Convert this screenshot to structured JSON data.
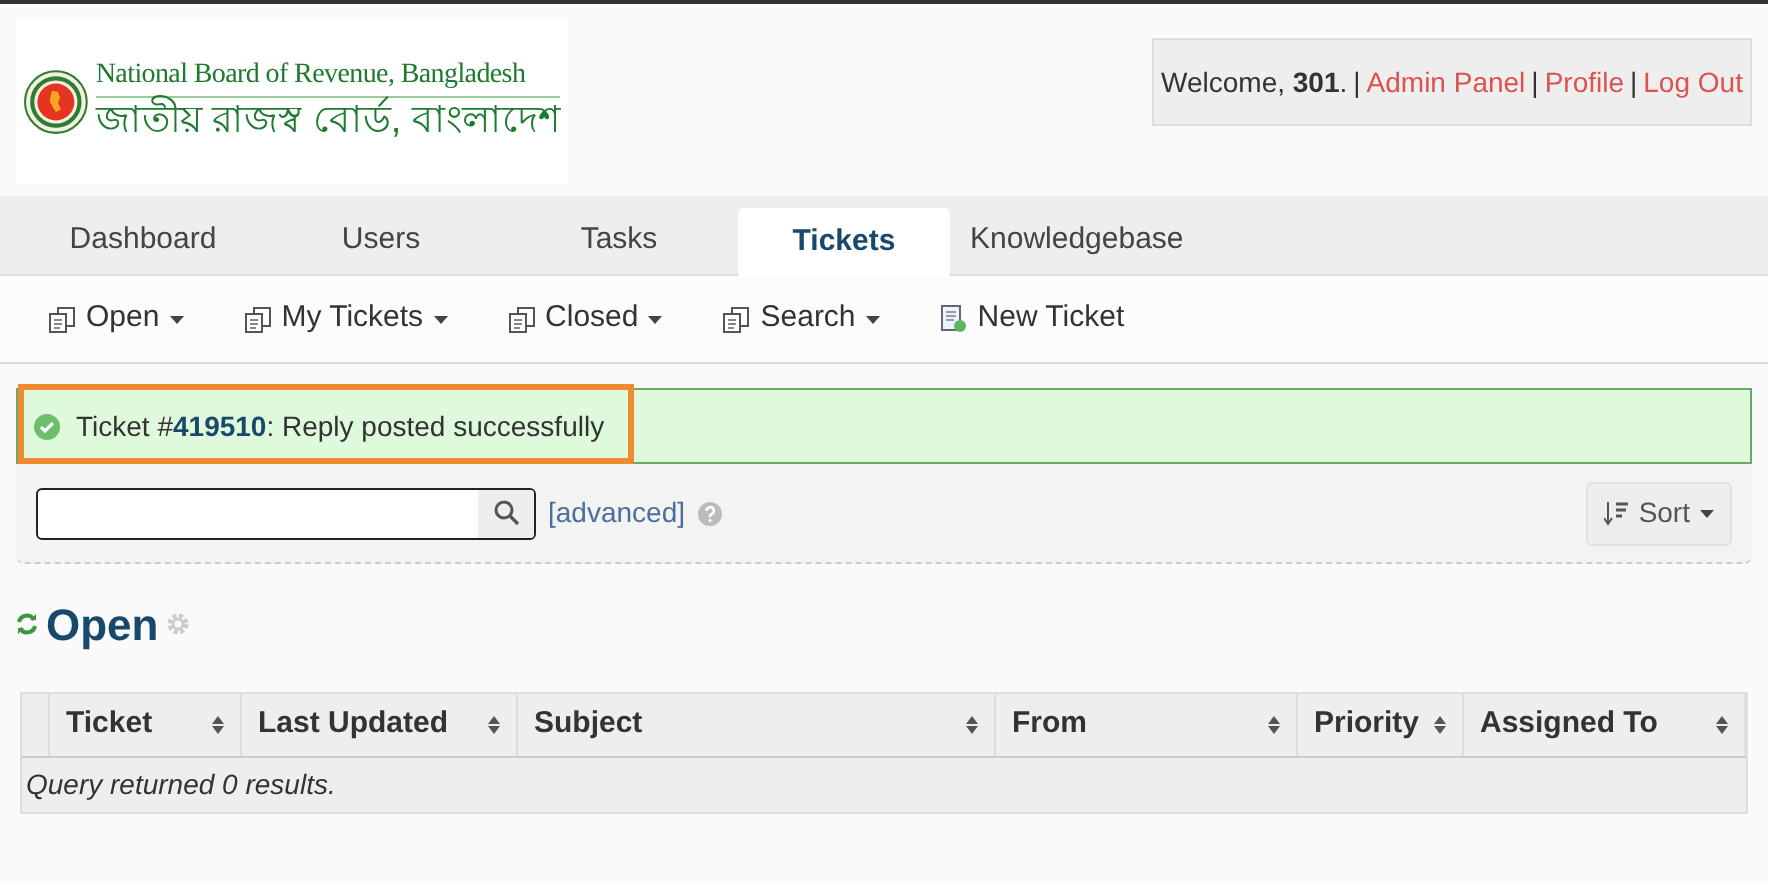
{
  "logo": {
    "english": "National Board of Revenue, Bangladesh",
    "bengali": "জাতীয় রাজস্ব বোর্ড, বাংলাদেশ"
  },
  "user_box": {
    "greeting": "Welcome, ",
    "user": "301",
    "period": ".",
    "separator": "|",
    "links": [
      "Admin Panel",
      "Profile",
      "Log Out"
    ]
  },
  "tabs": [
    {
      "label": "Dashboard",
      "selected": false
    },
    {
      "label": "Users",
      "selected": false
    },
    {
      "label": "Tasks",
      "selected": false
    },
    {
      "label": "Tickets",
      "selected": true
    },
    {
      "label": "Knowledgebase",
      "selected": false
    }
  ],
  "subnav": [
    {
      "label": "Open",
      "kind": "dropdown"
    },
    {
      "label": "My Tickets",
      "kind": "dropdown"
    },
    {
      "label": "Closed",
      "kind": "dropdown"
    },
    {
      "label": "Search",
      "kind": "dropdown"
    },
    {
      "label": "New Ticket",
      "kind": "link"
    }
  ],
  "alert": {
    "prefix": "Ticket #",
    "number": "419510",
    "message": ": Reply posted successfully",
    "highlighted": true
  },
  "search": {
    "advanced": "[advanced]",
    "sort": "Sort"
  },
  "queue": {
    "title": "Open"
  },
  "table": {
    "columns": [
      "Ticket",
      "Last Updated",
      "Subject",
      "From",
      "Priority",
      "Assigned To"
    ],
    "empty_message": "Query returned 0 results."
  }
}
